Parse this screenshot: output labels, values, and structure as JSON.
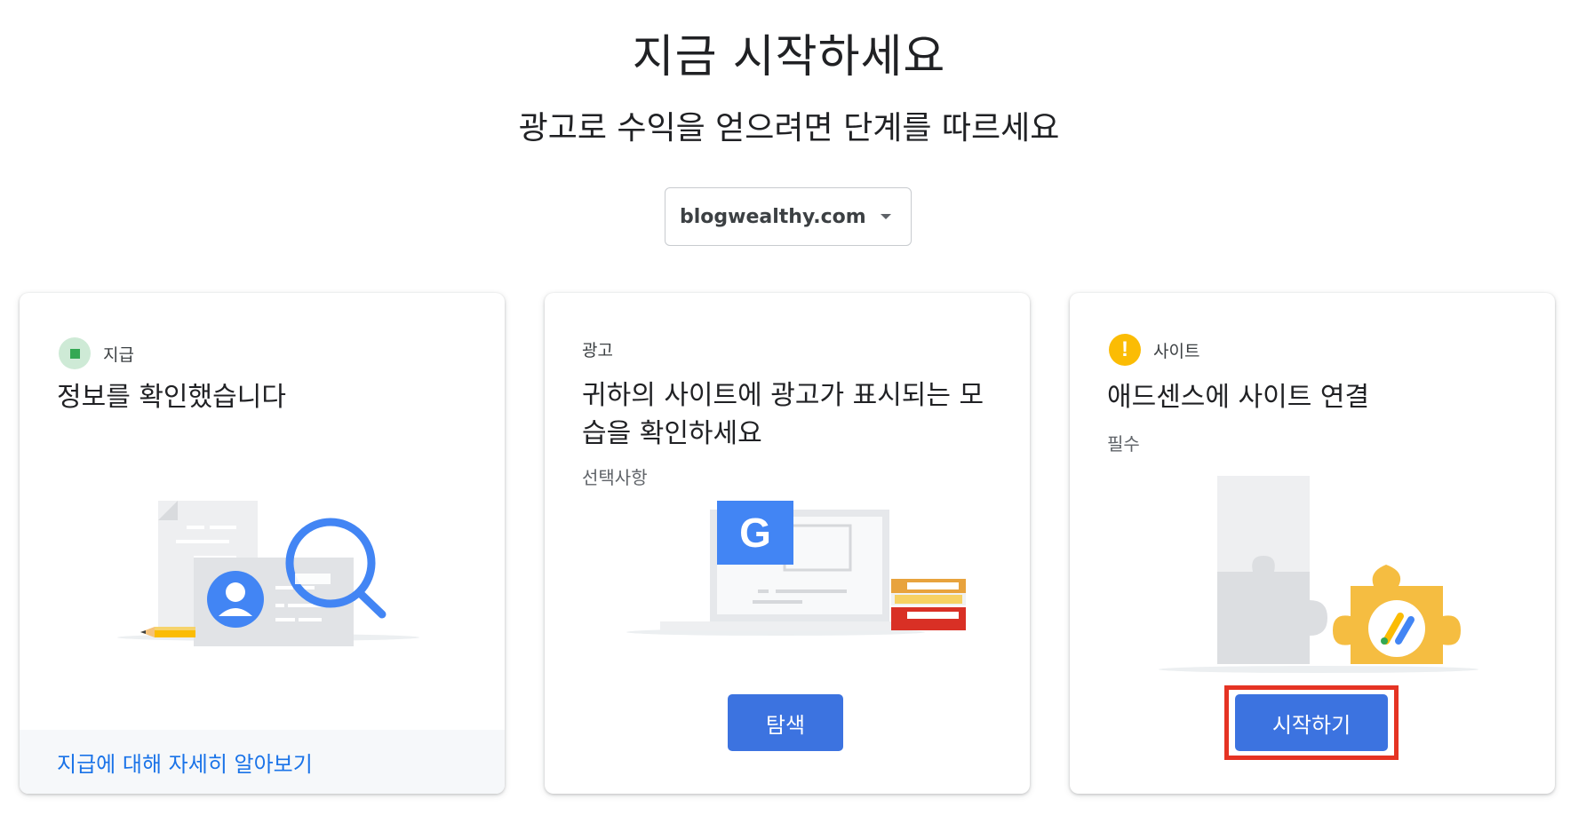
{
  "header": {
    "title": "지금 시작하세요",
    "subtitle": "광고로 수익을 얻으려면 단계를 따르세요"
  },
  "site_select": {
    "value": "blogwealthy.com"
  },
  "cards": {
    "payment": {
      "category": "지급",
      "status": "complete",
      "status_color": "#34a853",
      "heading": "정보를 확인했습니다",
      "footer_link": "지급에 대해 자세히 알아보기",
      "illustration_icon": "id-card-magnifier-icon"
    },
    "ads": {
      "category": "광고",
      "heading": "귀하의 사이트에 광고가 표시되는 모습을 확인하세요",
      "heading_line1": "귀하의 사이트에 광고가 표시되는 모",
      "heading_line2": "습을 확인하세요",
      "sub": "선택사항",
      "button_label": "탐색",
      "illustration_icon": "laptop-google-books-icon",
      "google_letter": "G"
    },
    "site": {
      "category": "사이트",
      "status": "warning",
      "status_color": "#fbbc04",
      "status_symbol": "!",
      "heading": "애드센스에 사이트 연결",
      "sub": "필수",
      "button_label": "시작하기",
      "illustration_icon": "puzzle-adsense-icon"
    }
  },
  "colors": {
    "accent": "#3c73e0",
    "link": "#1a73e8",
    "highlight": "#e53323"
  }
}
